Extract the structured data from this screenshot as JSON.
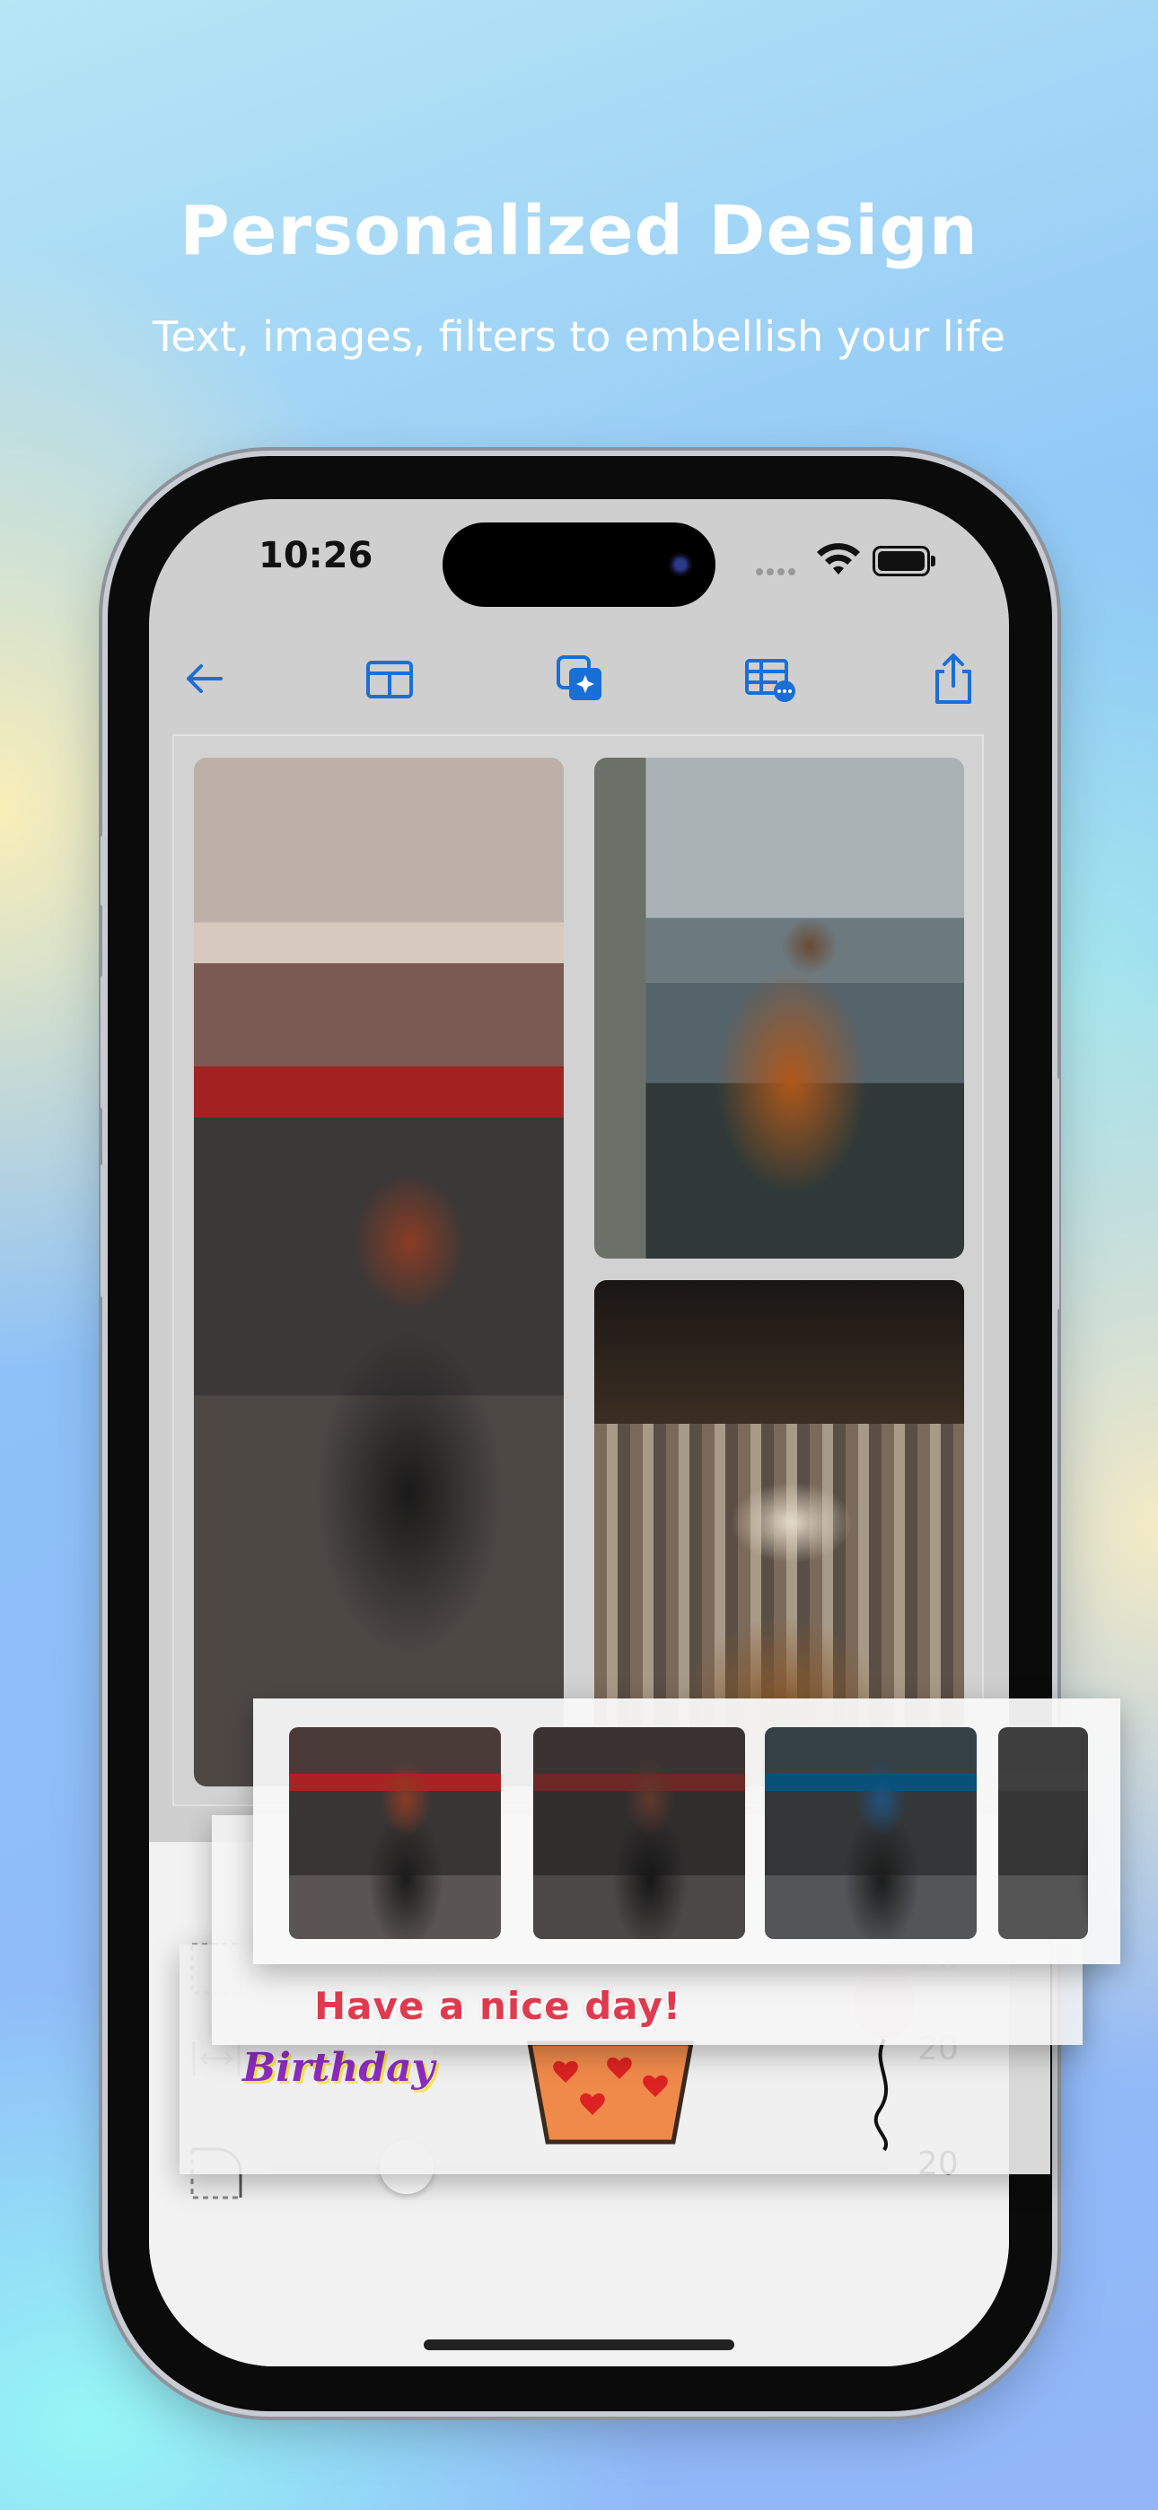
{
  "header": {
    "title": "Personalized Design",
    "subtitle": "Text, images, filters to embellish your life"
  },
  "status_bar": {
    "time": "10:26"
  },
  "toolbar": {
    "icons": [
      "back-arrow-icon",
      "layout-icon",
      "magic-image-icon",
      "table-more-icon",
      "share-icon"
    ],
    "accent_color": "#1a6fd6"
  },
  "stickers": {
    "text_sticker": "Have a nice day!",
    "birthday_sticker": "Birthday"
  },
  "sliders": [
    {
      "icon": "border-width-icon",
      "value": "20",
      "level": 0.22
    },
    {
      "icon": "spacing-icon",
      "value": "20",
      "level": 0.22
    },
    {
      "icon": "corner-radius-icon",
      "value": "20",
      "level": 0.22
    }
  ]
}
